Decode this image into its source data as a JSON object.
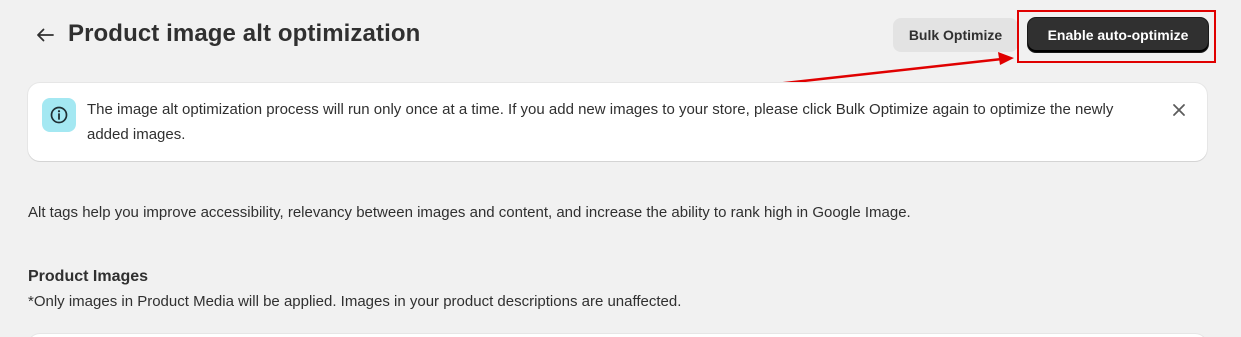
{
  "header": {
    "title": "Product image alt optimization",
    "back_icon": "arrow-left-icon",
    "bulk_optimize_label": "Bulk Optimize",
    "enable_auto_optimize_label": "Enable auto-optimize"
  },
  "banner": {
    "icon": "info-icon",
    "message": "The image alt optimization process will run only once at a time. If you add new images to your store, please click Bulk Optimize again to optimize the newly added images.",
    "close_icon": "close-icon"
  },
  "description": "Alt tags help you improve accessibility, relevancy between images and content, and increase the ability to rank high in Google Image.",
  "product_images": {
    "heading": "Product Images",
    "note": "*Only images in Product Media will be applied. Images in your product descriptions are unaffected."
  },
  "colors": {
    "background": "#f1f1f1",
    "primary_button": "#303030",
    "secondary_button": "#e3e3e3",
    "info_icon_bg": "#a4e8f2",
    "annotation": "#e00000"
  }
}
